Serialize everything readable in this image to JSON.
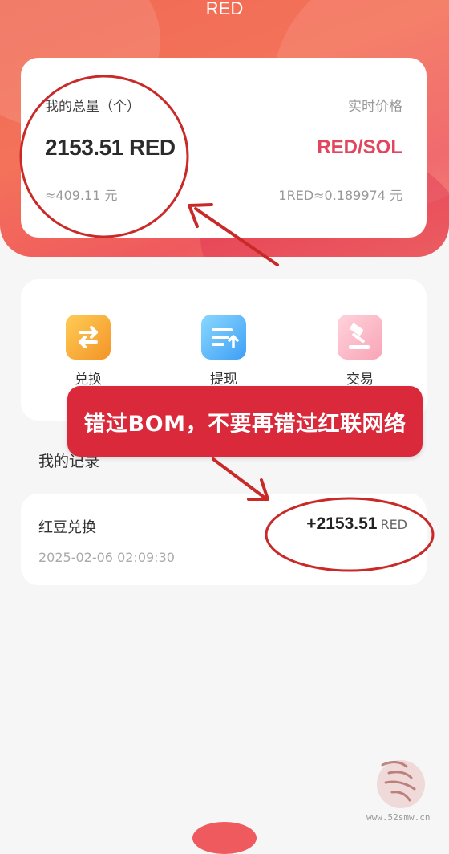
{
  "header": {
    "title": "RED"
  },
  "summary_card": {
    "total_label": "我的总量（个）",
    "price_label": "实时价格",
    "total_amount": "2153.51 RED",
    "pair": "RED/SOL",
    "cny_value": "≈409.11 元",
    "rate": "1RED≈0.189974 元"
  },
  "actions": [
    {
      "label": "兑换",
      "icon": "exchange-icon"
    },
    {
      "label": "提现",
      "icon": "withdraw-icon"
    },
    {
      "label": "交易",
      "icon": "gavel-icon"
    }
  ],
  "records_title": "我的记录",
  "records": [
    {
      "name": "红豆兑换",
      "amount": "+2153.51",
      "unit": "RED",
      "time": "2025-02-06 02:09:30"
    }
  ],
  "annotation": {
    "banner_text": "错过BOM，不要再错过红联网络",
    "color": "#d9293a"
  },
  "watermark": {
    "site": "www.52smw.cn"
  },
  "colors": {
    "accent": "#ef5a5e",
    "pair": "#e2455e"
  }
}
